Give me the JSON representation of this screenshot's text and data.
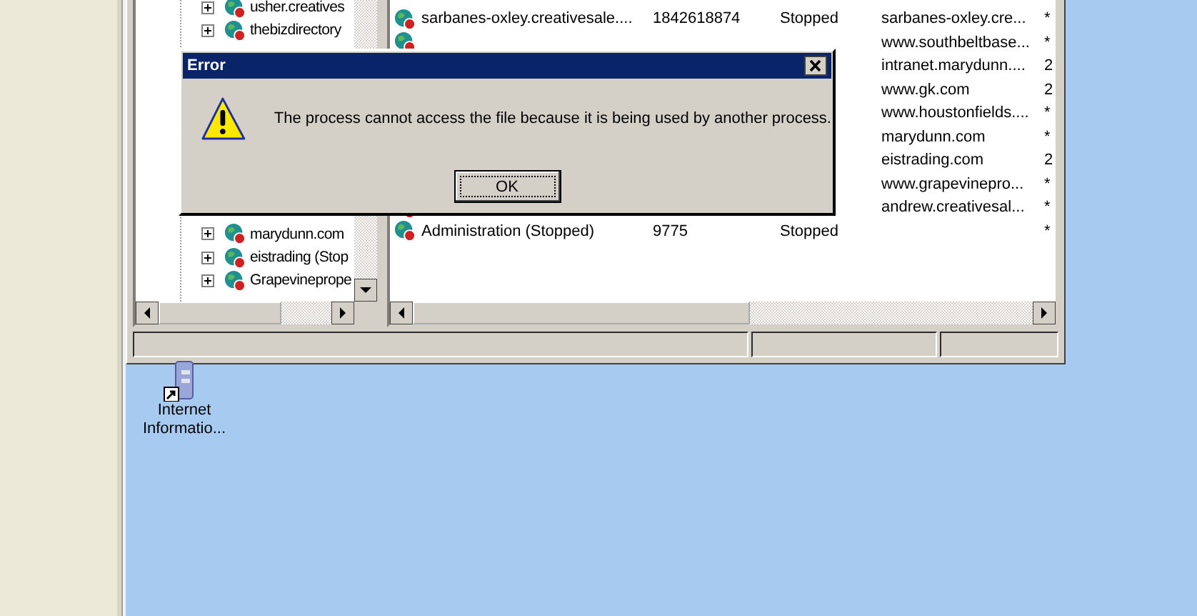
{
  "tree": {
    "items": [
      {
        "label": "usher.creatives",
        "expanded": false
      },
      {
        "label": "thebizdirectory",
        "expanded": false
      }
    ],
    "items_below_dialog": [
      {
        "label": "marydunn.com",
        "expanded": false
      },
      {
        "label": "eistrading (Stop",
        "expanded": false
      },
      {
        "label": "Grapevineprope",
        "expanded": false
      }
    ]
  },
  "list": {
    "rows": [
      {
        "column_1": "sarbanes-oxley.creativesale....",
        "column_2": "1842618874",
        "column_3": "Stopped",
        "column_4": "sarbanes-oxley.cre...",
        "column_5": "*"
      },
      {
        "column_4": "www.southbeltbase...",
        "column_5": "*"
      },
      {
        "column_4": "intranet.marydunn....",
        "column_5": "2"
      },
      {
        "column_4": "www.gk.com",
        "column_5": "2"
      },
      {
        "column_4": "www.houstonfields....",
        "column_5": "*"
      },
      {
        "column_4": "marydunn.com",
        "column_5": "*"
      },
      {
        "column_4": "eistrading.com",
        "column_5": "2"
      },
      {
        "column_4": "www.grapevinepro...",
        "column_5": "*"
      },
      {
        "column_4": "andrew.creativesal...",
        "column_5": "*"
      },
      {
        "column_1": "Administration (Stopped)",
        "column_2": "9775",
        "column_3": "Stopped",
        "column_5": "*"
      }
    ]
  },
  "desktop_icon": {
    "label": "Internet Informatio..."
  },
  "dialog": {
    "title": "Error",
    "message": "The process cannot access the file because it is being used by another process.",
    "buttons": [
      {
        "label": "OK",
        "focused": true
      }
    ]
  }
}
